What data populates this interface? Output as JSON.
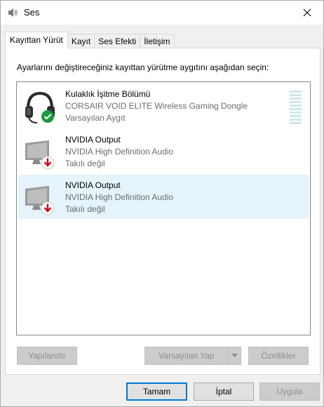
{
  "window": {
    "title": "Ses",
    "icon": "speaker-icon",
    "close_icon": "close-icon"
  },
  "tabs": [
    {
      "label": "Kayıttan Yürüt",
      "active": true
    },
    {
      "label": "Kayıt",
      "active": false
    },
    {
      "label": "Ses Efekti",
      "active": false
    },
    {
      "label": "İletişim",
      "active": false
    }
  ],
  "panel": {
    "instruction": "Ayarlarını değiştireceğiniz kayıttan yürütme aygıtını aşağıdan seçin:",
    "devices": [
      {
        "name": "Kulaklık İşitme Bölümü",
        "description": "CORSAIR VOID ELITE Wireless Gaming Dongle",
        "status": "Varsayılan Aygıt",
        "icon": "headset-icon",
        "badge": "check-badge-icon",
        "selected": false
      },
      {
        "name": "NVIDIA Output",
        "description": "NVIDIA High Definition Audio",
        "status": "Takılı değil",
        "icon": "monitor-icon",
        "badge": "unplugged-badge-icon",
        "selected": false
      },
      {
        "name": "NVIDIA Output",
        "description": "NVIDIA High Definition Audio",
        "status": "Takılı değil",
        "icon": "monitor-icon",
        "badge": "unplugged-badge-icon",
        "selected": true
      }
    ],
    "configure_label": "Yapılandır",
    "set_default_label": "Varsayılan Yap",
    "properties_label": "Özellikler"
  },
  "footer": {
    "ok_label": "Tamam",
    "cancel_label": "İptal",
    "apply_label": "Uygula"
  },
  "colors": {
    "selection": "#e5f3fb",
    "default_button_border": "#0078d7",
    "check_badge": "#1a9b3c",
    "unplugged_badge": "#d0021b"
  }
}
